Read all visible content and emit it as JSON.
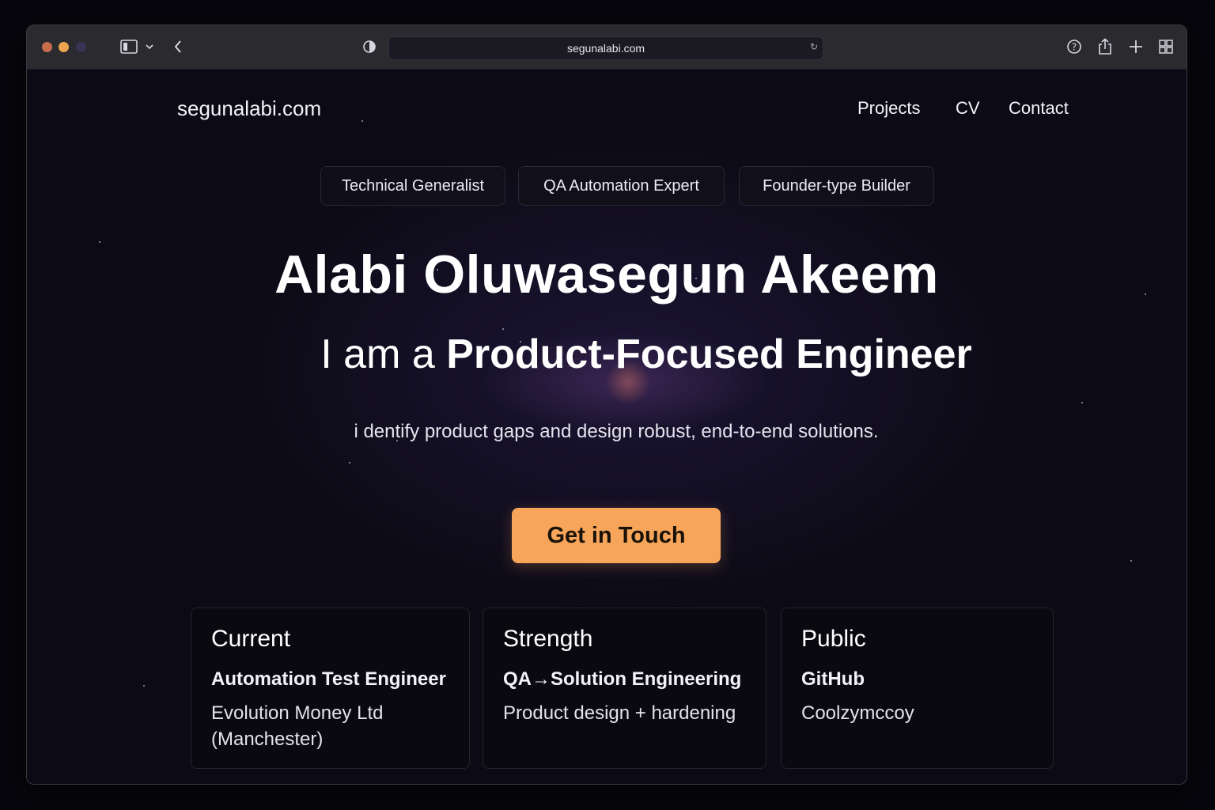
{
  "browser": {
    "url": "segunalabi.com"
  },
  "site": {
    "logo": "segunalabi.com",
    "nav": [
      "Projects",
      "CV",
      "Contact"
    ]
  },
  "pills": [
    "Technical Generalist",
    "QA Automation Expert",
    "Founder-type Builder"
  ],
  "hero": {
    "name": "Alabi Oluwasegun Akeem",
    "role_prefix": "I am a",
    "role_highlight": "Product-Focused Engineer",
    "tagline": "i dentify product gaps and design robust, end-to-end solutions.",
    "cta_label": "Get in Touch"
  },
  "cards": [
    {
      "title": "Current",
      "line1": "Automation Test Engineer",
      "line2": "Evolution Money Ltd (Manchester)"
    },
    {
      "title": "Strength",
      "line1": "QA→Solution Engineering",
      "line2": "Product design + hardening"
    },
    {
      "title": "Public",
      "line1": "GitHub",
      "line2": "Coolzymccoy"
    }
  ],
  "colors": {
    "accent": "#f6a55a",
    "background": "#0c0a14"
  }
}
